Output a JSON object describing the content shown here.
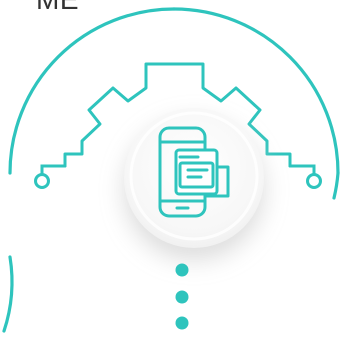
{
  "header": {
    "partial_text": "ME"
  },
  "graphic": {
    "name": "mobile-app-development-graphic",
    "center_icon": "mobile-app-icon",
    "outline_icon": "gear-icon",
    "ellipsis_icon": "vertical-dots-icon"
  },
  "colors": {
    "accent": "#2ec4bd",
    "accent_dark": "#22a79f",
    "text": "#333333",
    "shadow": "#d9d9d9"
  }
}
